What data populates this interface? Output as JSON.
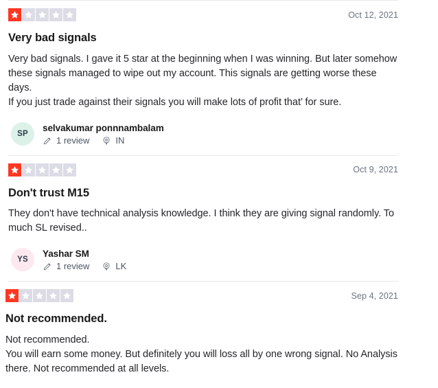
{
  "colors": {
    "star_filled": "#ff3722",
    "star_empty": "#dcdce6",
    "divider": "#e6e7ea",
    "date_text": "#6b7280",
    "title_text": "#191919",
    "body_text": "#242529"
  },
  "icons": {
    "star": "star-icon",
    "pencil": "pencil-icon",
    "location": "location-pin-icon"
  },
  "reviews": [
    {
      "rating": 1,
      "max_rating": 5,
      "date": "Oct 12, 2021",
      "title": "Very bad signals",
      "body": "Very bad signals. I gave it 5 star at the beginning when I was winning. But later somehow these signals managed to wipe out my account. This signals are getting worse these days.\nIf you just trade against their signals you will make lots of profit that’ for sure.",
      "author": {
        "initials": "SP",
        "name": "selvakumar ponnnambalam",
        "avatar_color": "#dcf1e8",
        "reviews_count": "1 review",
        "country": "IN"
      }
    },
    {
      "rating": 1,
      "max_rating": 5,
      "date": "Oct 9, 2021",
      "title": "Don't trust M15",
      "body": "They don't have technical analysis knowledge. I think they are giving signal randomly. To much SL revised..",
      "author": {
        "initials": "YS",
        "name": "Yashar SM",
        "avatar_color": "#fce8ee",
        "reviews_count": "1 review",
        "country": "LK"
      }
    },
    {
      "rating": 1,
      "max_rating": 5,
      "date": "Sep 4, 2021",
      "title": "Not recommended.",
      "body": "Not recommended.\nYou will earn some money. But definitely you will loss all by one wrong signal. No Analysis there. Not recommended at all levels.",
      "author": null
    }
  ]
}
